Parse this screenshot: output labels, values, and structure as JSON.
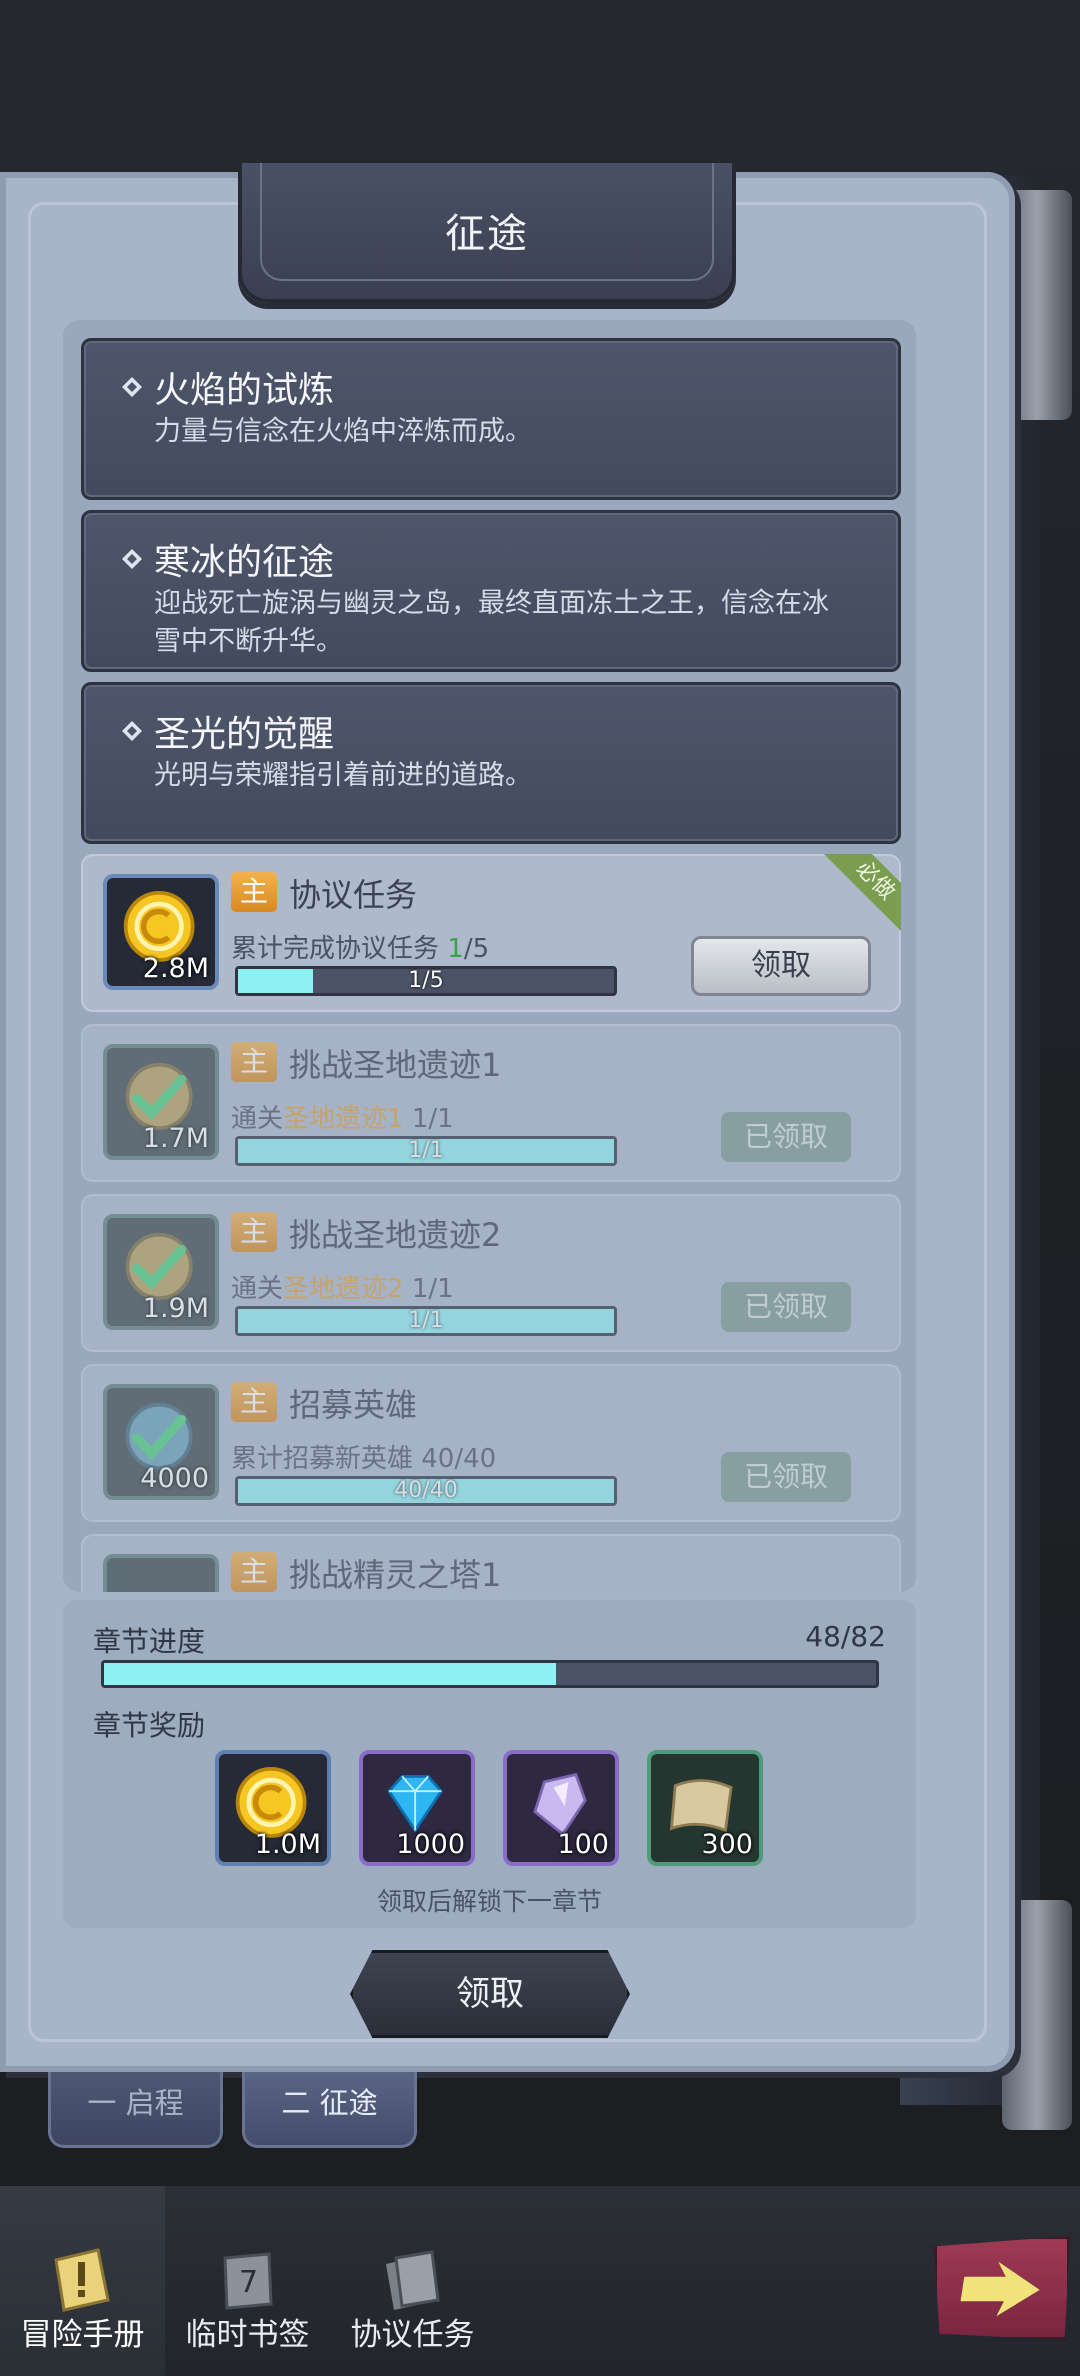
{
  "header": {
    "title": "征途"
  },
  "chapters": [
    {
      "title": "火焰的试炼",
      "desc": "力量与信念在火焰中淬炼而成。"
    },
    {
      "title": "寒冰的征途",
      "desc": "迎战死亡旋涡与幽灵之岛，最终直面冻土之王，信念在冰雪中不断升华。"
    },
    {
      "title": "圣光的觉醒",
      "desc": "光明与荣耀指引着前进的道路。"
    }
  ],
  "tasks": [
    {
      "badge": "主",
      "title": "协议任务",
      "desc_prefix": "累计完成协议任务 ",
      "desc_highlight": "1",
      "desc_suffix": "/5",
      "progress_text": "1/5",
      "progress": 0.2,
      "reward_amount": "2.8M",
      "button": "领取",
      "tag": "必做"
    },
    {
      "badge": "主",
      "title": "挑战圣地遗迹1",
      "desc_prefix": "通关",
      "desc_loc": "圣地遗迹1",
      "desc_suffix": " 1/1",
      "progress_text": "1/1",
      "progress": 1.0,
      "reward_amount": "1.7M",
      "button": "已领取"
    },
    {
      "badge": "主",
      "title": "挑战圣地遗迹2",
      "desc_prefix": "通关",
      "desc_loc": "圣地遗迹2",
      "desc_suffix": " 1/1",
      "progress_text": "1/1",
      "progress": 1.0,
      "reward_amount": "1.9M",
      "button": "已领取"
    },
    {
      "badge": "主",
      "title": "招募英雄",
      "desc_prefix": "累计招募新英雄 40/40",
      "progress_text": "40/40",
      "progress": 1.0,
      "reward_amount": "4000",
      "button": "已领取"
    },
    {
      "badge": "主",
      "title": "挑战精灵之塔1"
    }
  ],
  "summary": {
    "progress_label": "章节进度",
    "progress_value": "48/82",
    "progress": 0.585,
    "rewards_label": "章节奖励",
    "rewards": [
      {
        "icon": "gold-coin-icon",
        "amount": "1.0M"
      },
      {
        "icon": "blue-diamond-icon",
        "amount": "1000"
      },
      {
        "icon": "crystal-shard-icon",
        "amount": "100"
      },
      {
        "icon": "scroll-icon",
        "amount": "300"
      }
    ],
    "unlock_note": "领取后解锁下一章节",
    "claim_label": "领取"
  },
  "bookmark_tabs": [
    "一 启程",
    "二 征途"
  ],
  "bottom_nav": [
    "冒险手册",
    "临时书签",
    "协议任务"
  ],
  "colors": {
    "accent_cyan": "#8ff0f2",
    "panel_bg": "#a7b4c9",
    "badge_orange": "#e89a30",
    "must_green": "#7a9d50"
  }
}
